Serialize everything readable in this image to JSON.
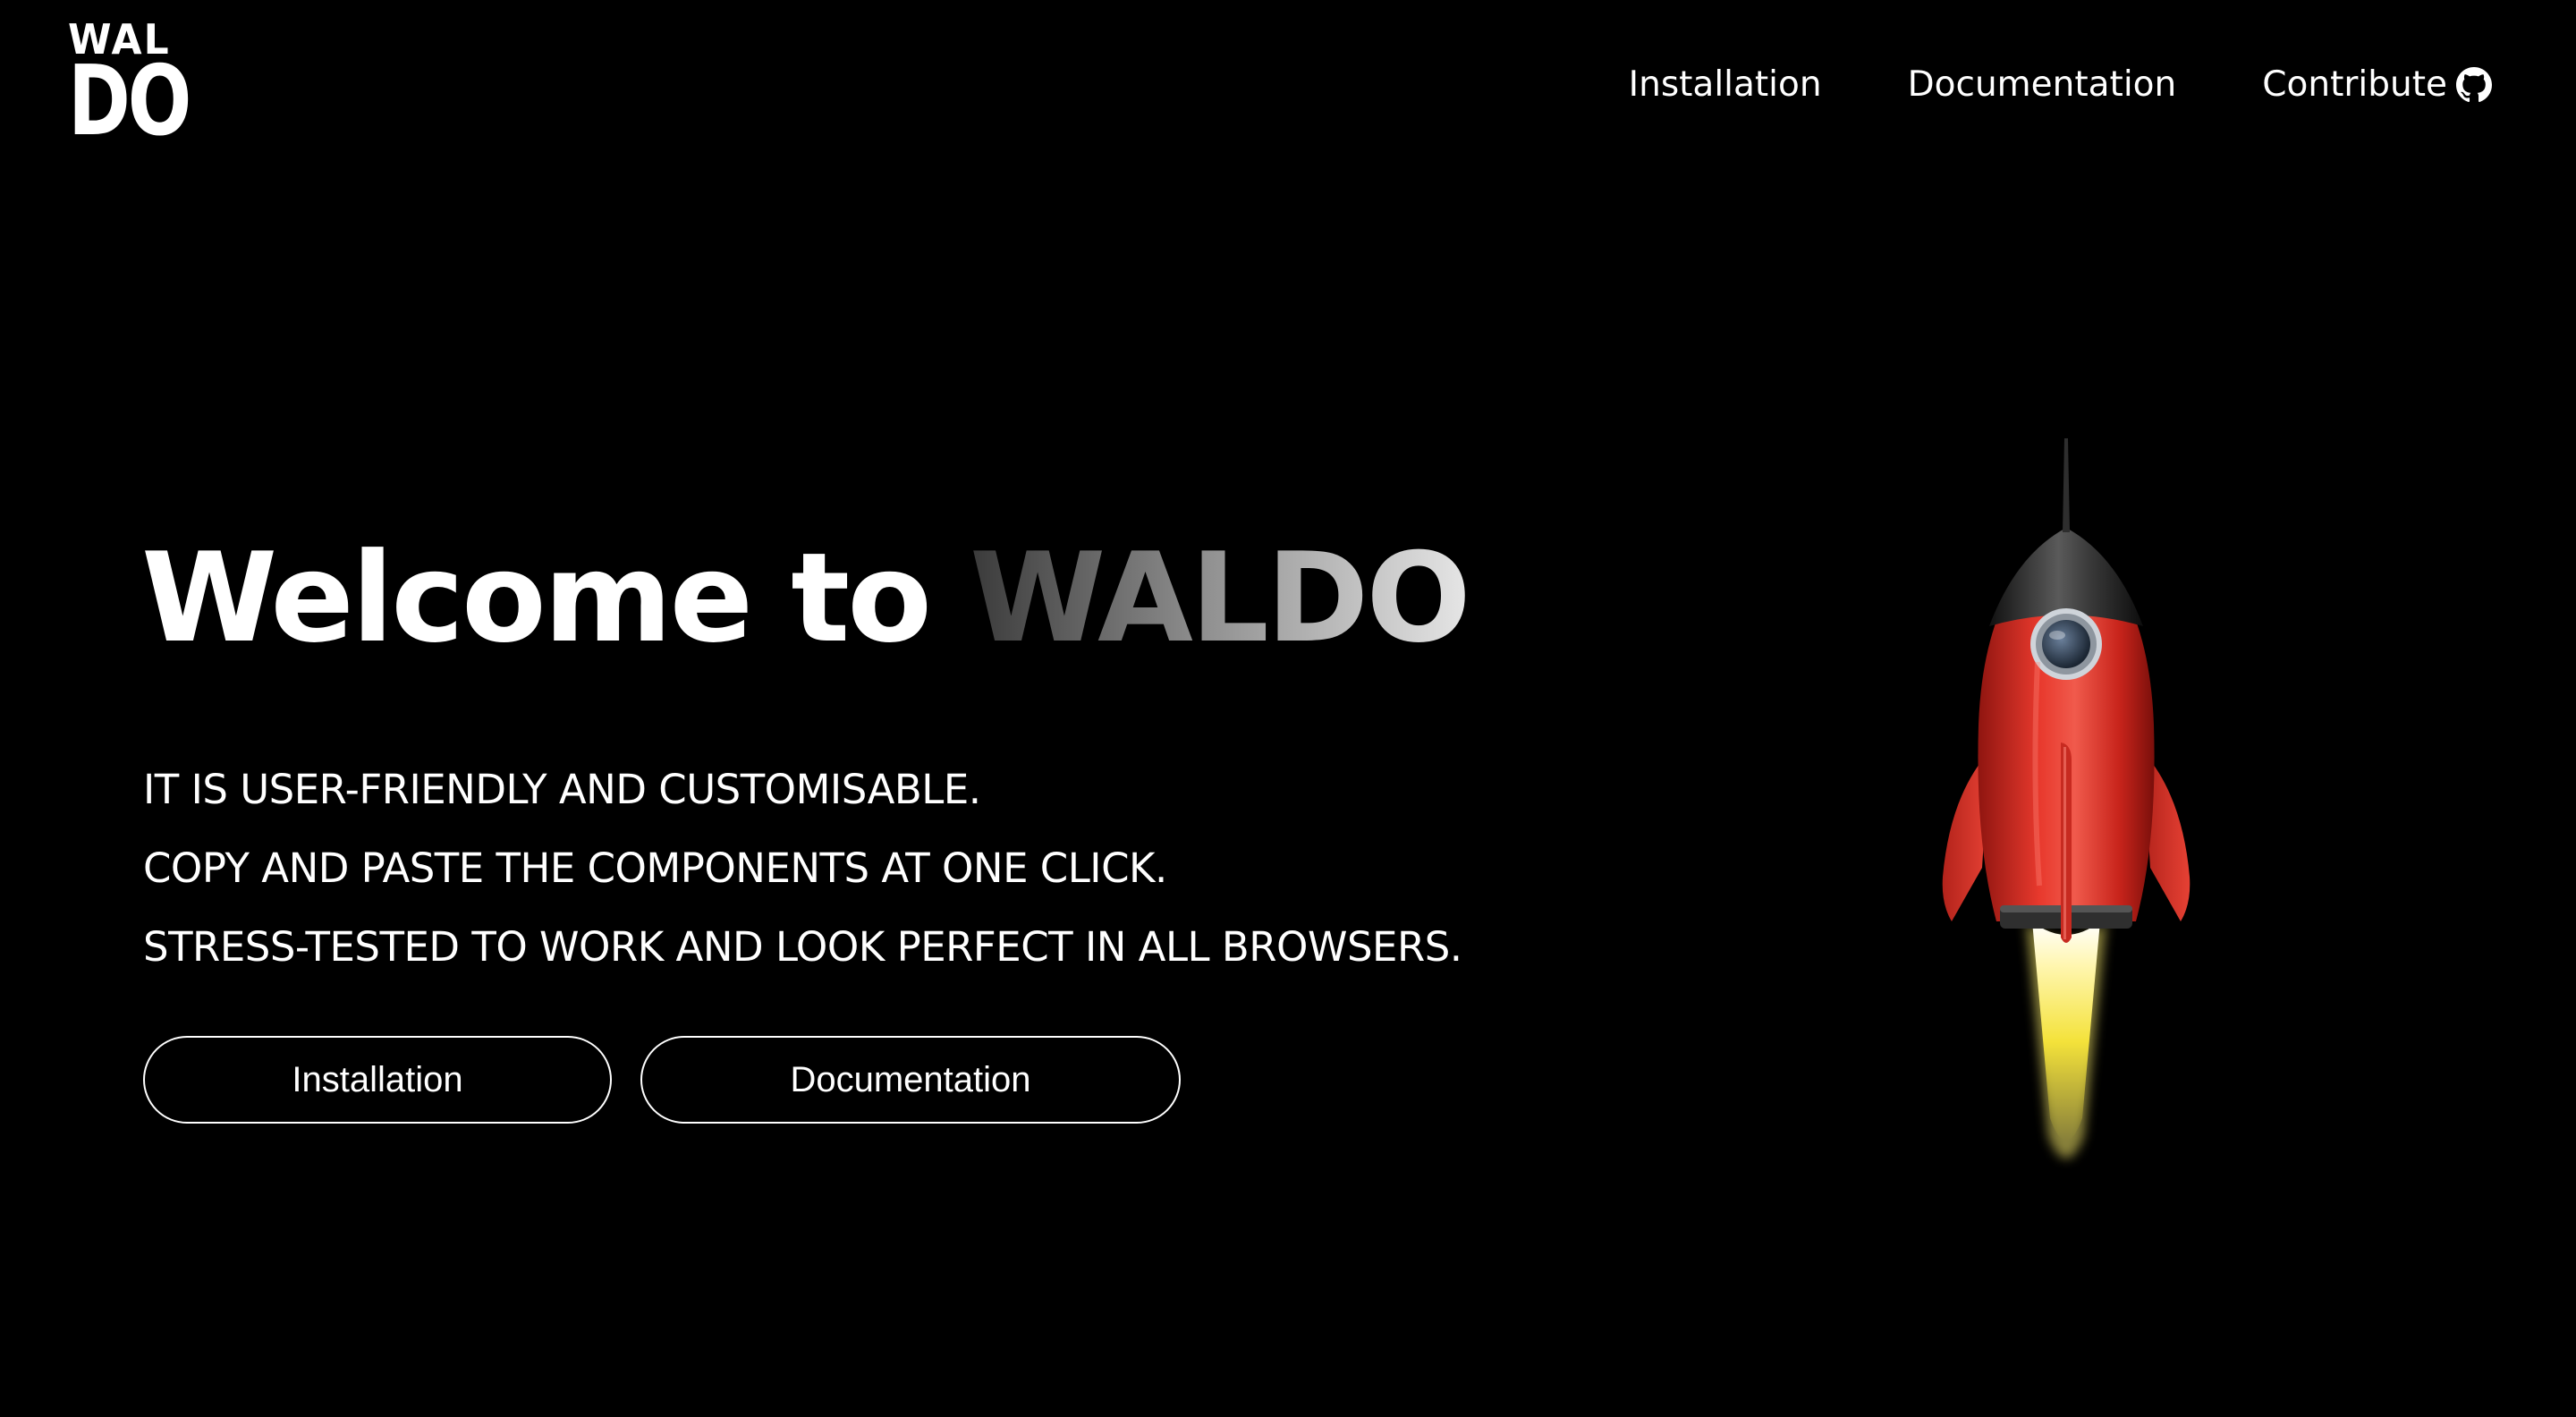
{
  "logo": {
    "line1": "WAL",
    "line2": "DO"
  },
  "nav": {
    "items": [
      {
        "label": "Installation"
      },
      {
        "label": "Documentation"
      },
      {
        "label": "Contribute",
        "icon": "github-icon"
      }
    ]
  },
  "hero": {
    "title_prefix": "Welcome to ",
    "title_brand": "WALDO",
    "features": [
      "IT IS USER-FRIENDLY AND CUSTOMISABLE.",
      "COPY AND PASTE THE COMPONENTS AT ONE CLICK.",
      "STRESS-TESTED TO WORK AND LOOK PERFECT IN ALL BROWSERS."
    ],
    "buttons": {
      "installation": "Installation",
      "documentation": "Documentation"
    }
  },
  "illustration": {
    "icon": "rocket-icon"
  },
  "colors": {
    "background": "#000000",
    "text": "#ffffff",
    "rocket_body": "#e0342b",
    "rocket_nose": "#2b2b2b",
    "flame": "#f5e93a"
  }
}
